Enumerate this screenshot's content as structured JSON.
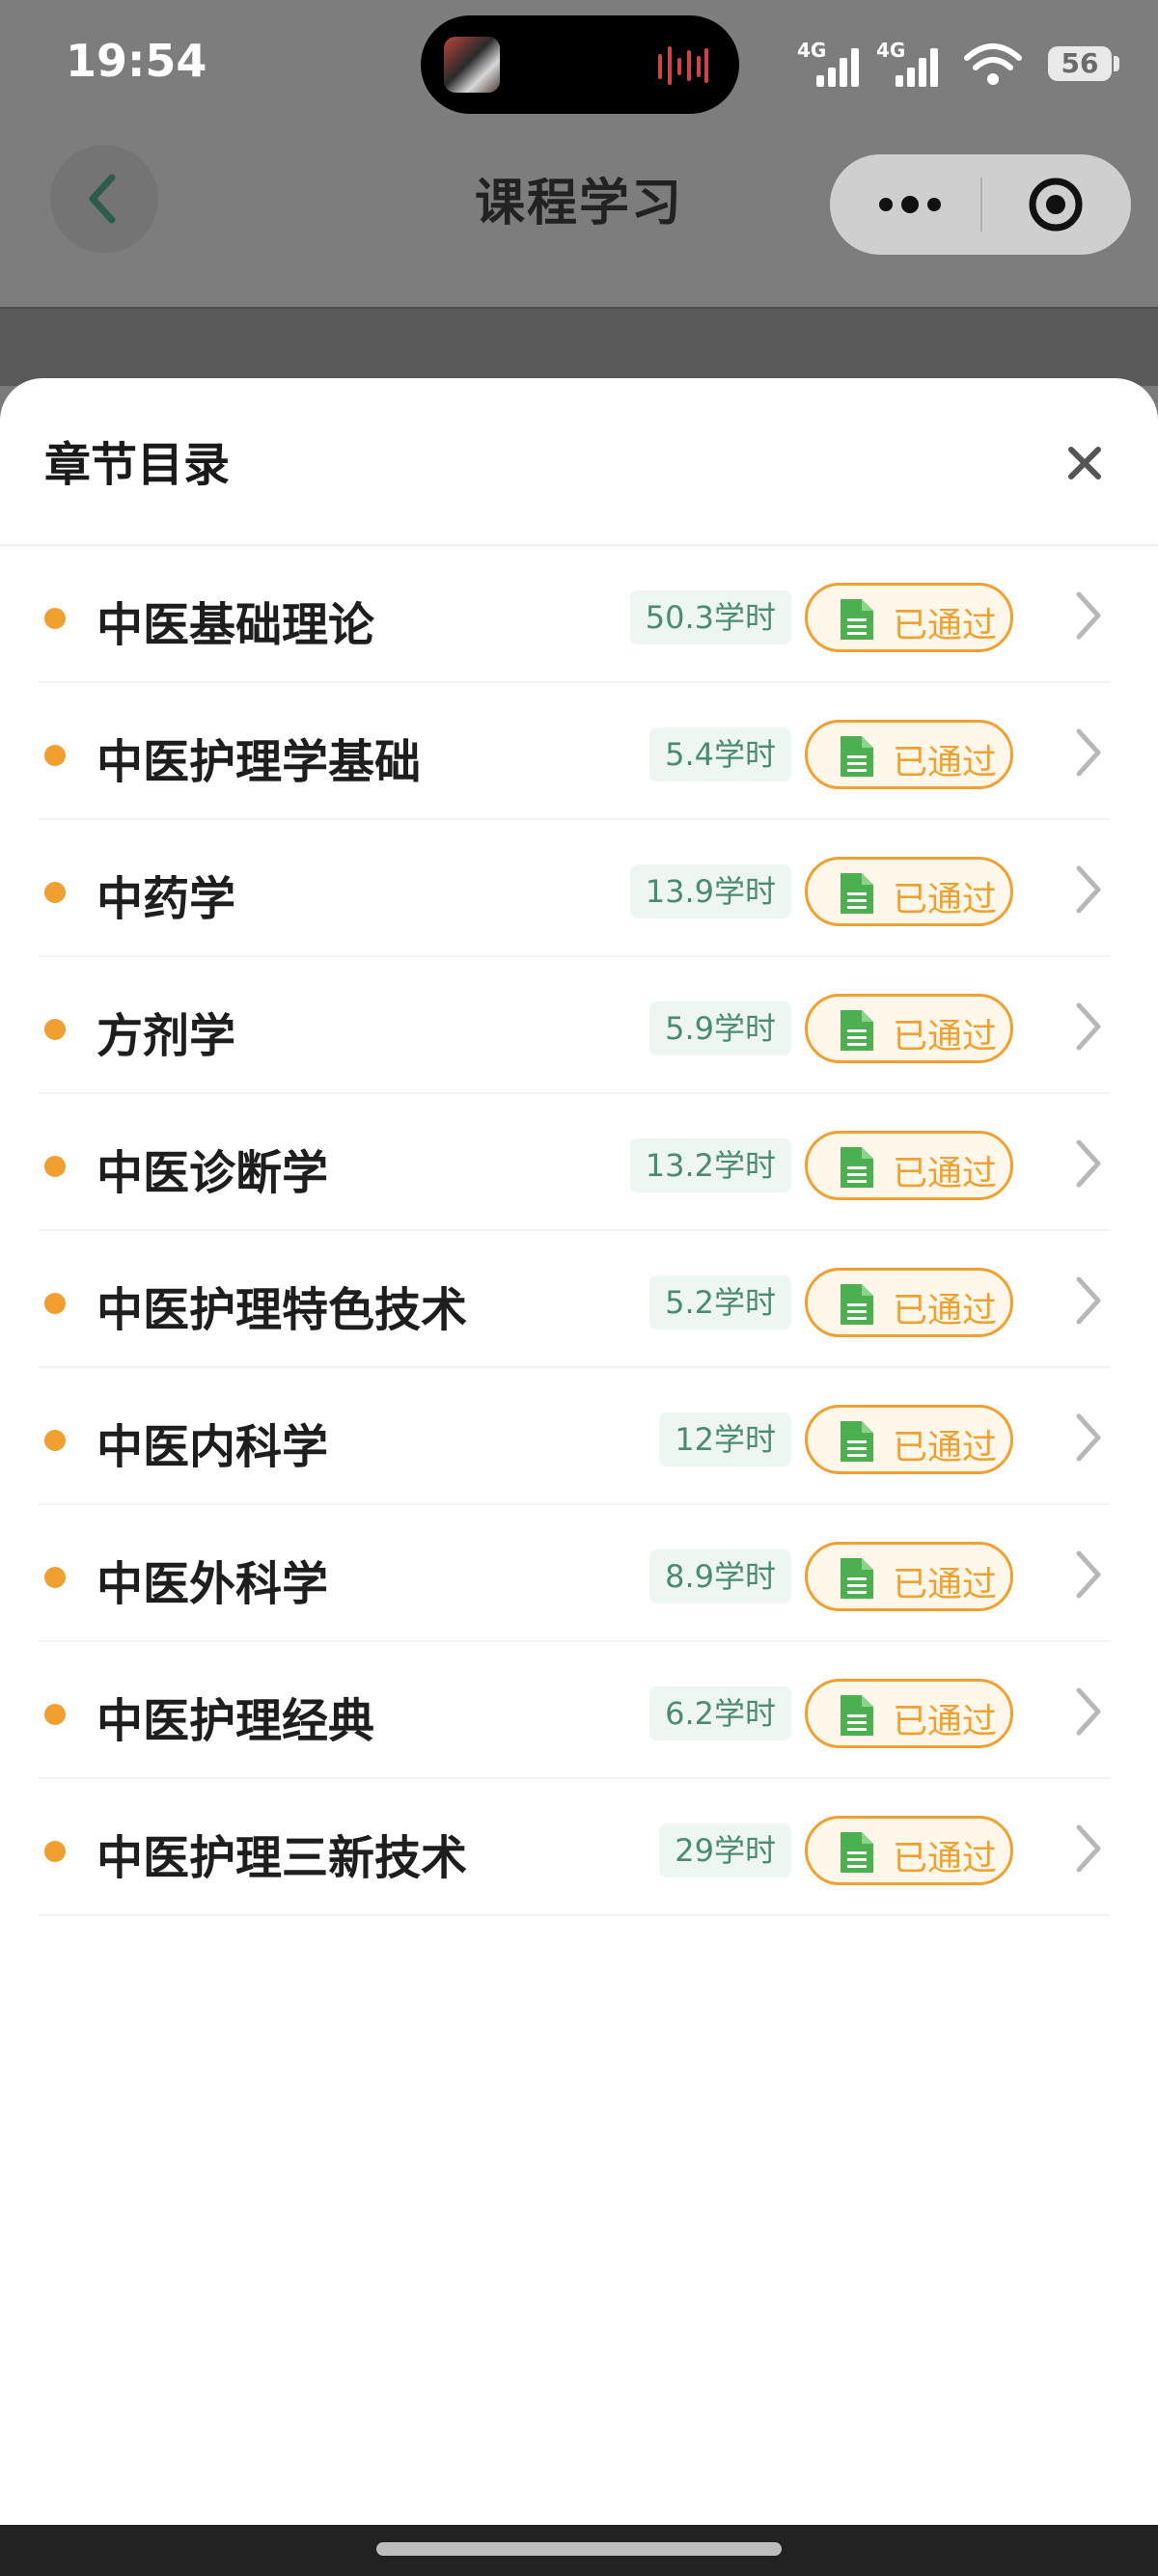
{
  "status_bar": {
    "time": "19:54",
    "network_1": "4G",
    "network_2": "4G",
    "battery": "56"
  },
  "nav": {
    "title": "课程学习",
    "back_icon": "chevron-left-icon",
    "more_icon": "more-dots-icon",
    "target_icon": "target-circle-icon"
  },
  "sheet": {
    "title": "章节目录",
    "close_icon": "close-icon",
    "chapters": [
      {
        "title": "中医基础理论",
        "hours": "50.3学时",
        "status": "已通过"
      },
      {
        "title": "中医护理学基础",
        "hours": "5.4学时",
        "status": "已通过"
      },
      {
        "title": "中药学",
        "hours": "13.9学时",
        "status": "已通过"
      },
      {
        "title": "方剂学",
        "hours": "5.9学时",
        "status": "已通过"
      },
      {
        "title": "中医诊断学",
        "hours": "13.2学时",
        "status": "已通过"
      },
      {
        "title": "中医护理特色技术",
        "hours": "5.2学时",
        "status": "已通过"
      },
      {
        "title": "中医内科学",
        "hours": "12学时",
        "status": "已通过"
      },
      {
        "title": "中医外科学",
        "hours": "8.9学时",
        "status": "已通过"
      },
      {
        "title": "中医护理经典",
        "hours": "6.2学时",
        "status": "已通过"
      },
      {
        "title": "中医护理三新技术",
        "hours": "29学时",
        "status": "已通过"
      }
    ]
  },
  "colors": {
    "accent_orange": "#f0a030",
    "doc_green": "#4caf50",
    "hours_text": "#4c8a73",
    "hours_bg": "#eef6f2"
  }
}
